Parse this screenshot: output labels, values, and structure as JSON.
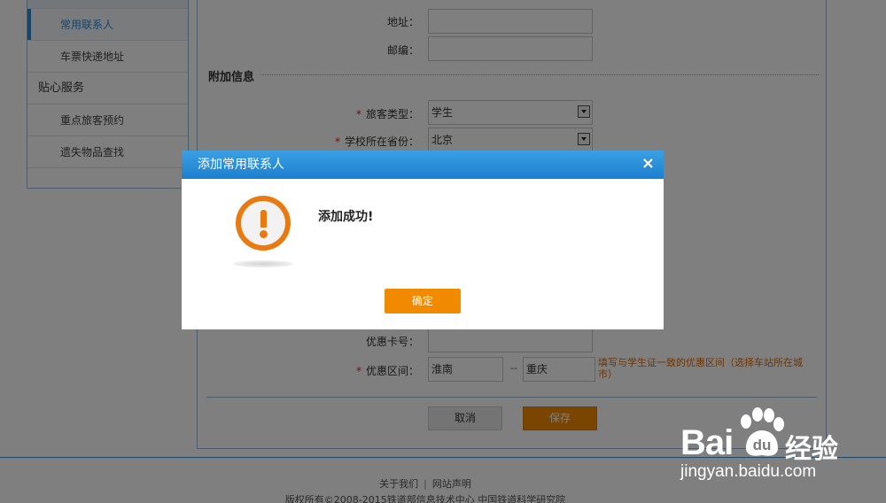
{
  "sidebar": {
    "items": [
      {
        "label": "常用联系人",
        "active": true
      },
      {
        "label": "车票快递地址",
        "active": false
      }
    ],
    "section": "贴心服务",
    "section_items": [
      "重点旅客预约",
      "遗失物品查找"
    ]
  },
  "form": {
    "address_label": "地址：",
    "zip_label": "邮编：",
    "extra_title": "附加信息",
    "passenger_type_label": "旅客类型：",
    "passenger_type_value": "学生",
    "school_province_label": "学校所在省份：",
    "school_province_value": "北京",
    "discount_card_label": "优惠卡号：",
    "discount_range_label": "优惠区间：",
    "range_from": "淮南",
    "range_sep": "--",
    "range_to": "重庆",
    "range_hint": "填写与学生证一致的优惠区间（选择车站所在城市）",
    "required_mark": "*",
    "cancel_label": "取消",
    "save_label": "保存"
  },
  "footer": {
    "about": "关于我们",
    "separator": "|",
    "statement": "网站声明",
    "copyright": "版权所有©2008-2015铁道部信息技术中心  中国铁道科学研究院"
  },
  "dialog": {
    "title": "添加常用联系人",
    "close_glyph": "×",
    "message": "添加成功!",
    "ok_label": "确定"
  },
  "watermark": {
    "brand": "Bai",
    "suffix": "经验",
    "url": "jingyan.baidu.com"
  },
  "colors": {
    "accent_blue": "#2c8bd4",
    "orange": "#f28a00",
    "required": "#e02020"
  }
}
